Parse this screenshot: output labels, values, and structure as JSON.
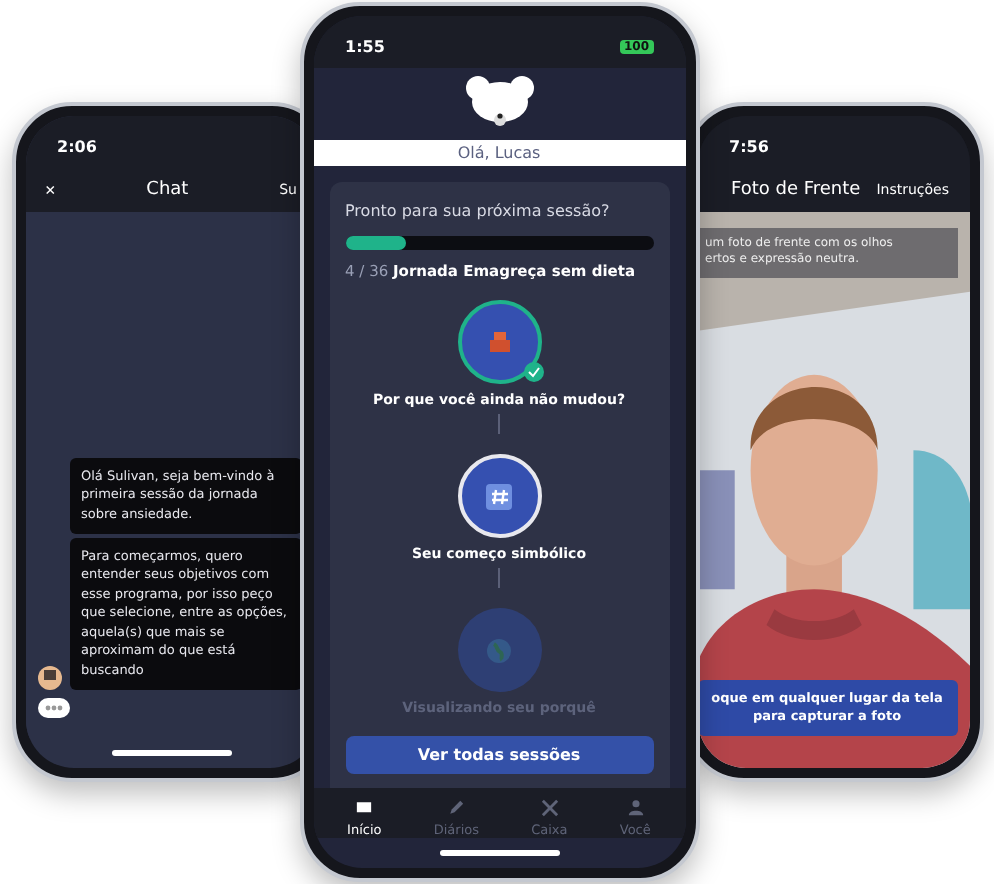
{
  "chat_phone": {
    "status_time": "2:06",
    "close": "×",
    "title": "Chat",
    "action": "Su",
    "messages": [
      "Olá Sulivan, seja bem-vindo à primeira sessão da jornada sobre ansiedade.",
      "Para começarmos, quero entender seus objetivos com esse programa, por isso peço que selecione, entre as opções, aquela(s) que mais se aproximam do que está buscando"
    ]
  },
  "home_phone": {
    "status_time": "1:55",
    "battery": "100",
    "greeting": "Olá, Lucas",
    "prompt": "Pronto para sua próxima sessão?",
    "progress": {
      "level": 0.2
    },
    "journey": "4 / 36 **Jornada Emagreça sem dieta**",
    "sessions": [
      {
        "title": "Por que você ainda não mudou?",
        "kind": "done"
      },
      {
        "title": "Seu começo simbólico",
        "kind": "current"
      },
      {
        "title": "Visualizando seu porquê",
        "kind": "locked"
      }
    ],
    "all_sessions_button": "Ver todas sessões",
    "tabs": [
      {
        "label": "Início",
        "selected": true
      },
      {
        "label": "Diários",
        "selected": false
      },
      {
        "label": "Caixa",
        "selected": false
      },
      {
        "label": "Você",
        "selected": false
      }
    ]
  },
  "camera_phone": {
    "status_time": "7:56",
    "title": "Foto de Frente",
    "instructions": "Instruções",
    "hint_lines": [
      "um foto de frente com os olhos",
      "ertos e expressão neutra."
    ],
    "capture_hint": "oque em qualquer lugar da tela para capturar a foto",
    "photo": {
      "kind": "picture"
    }
  }
}
